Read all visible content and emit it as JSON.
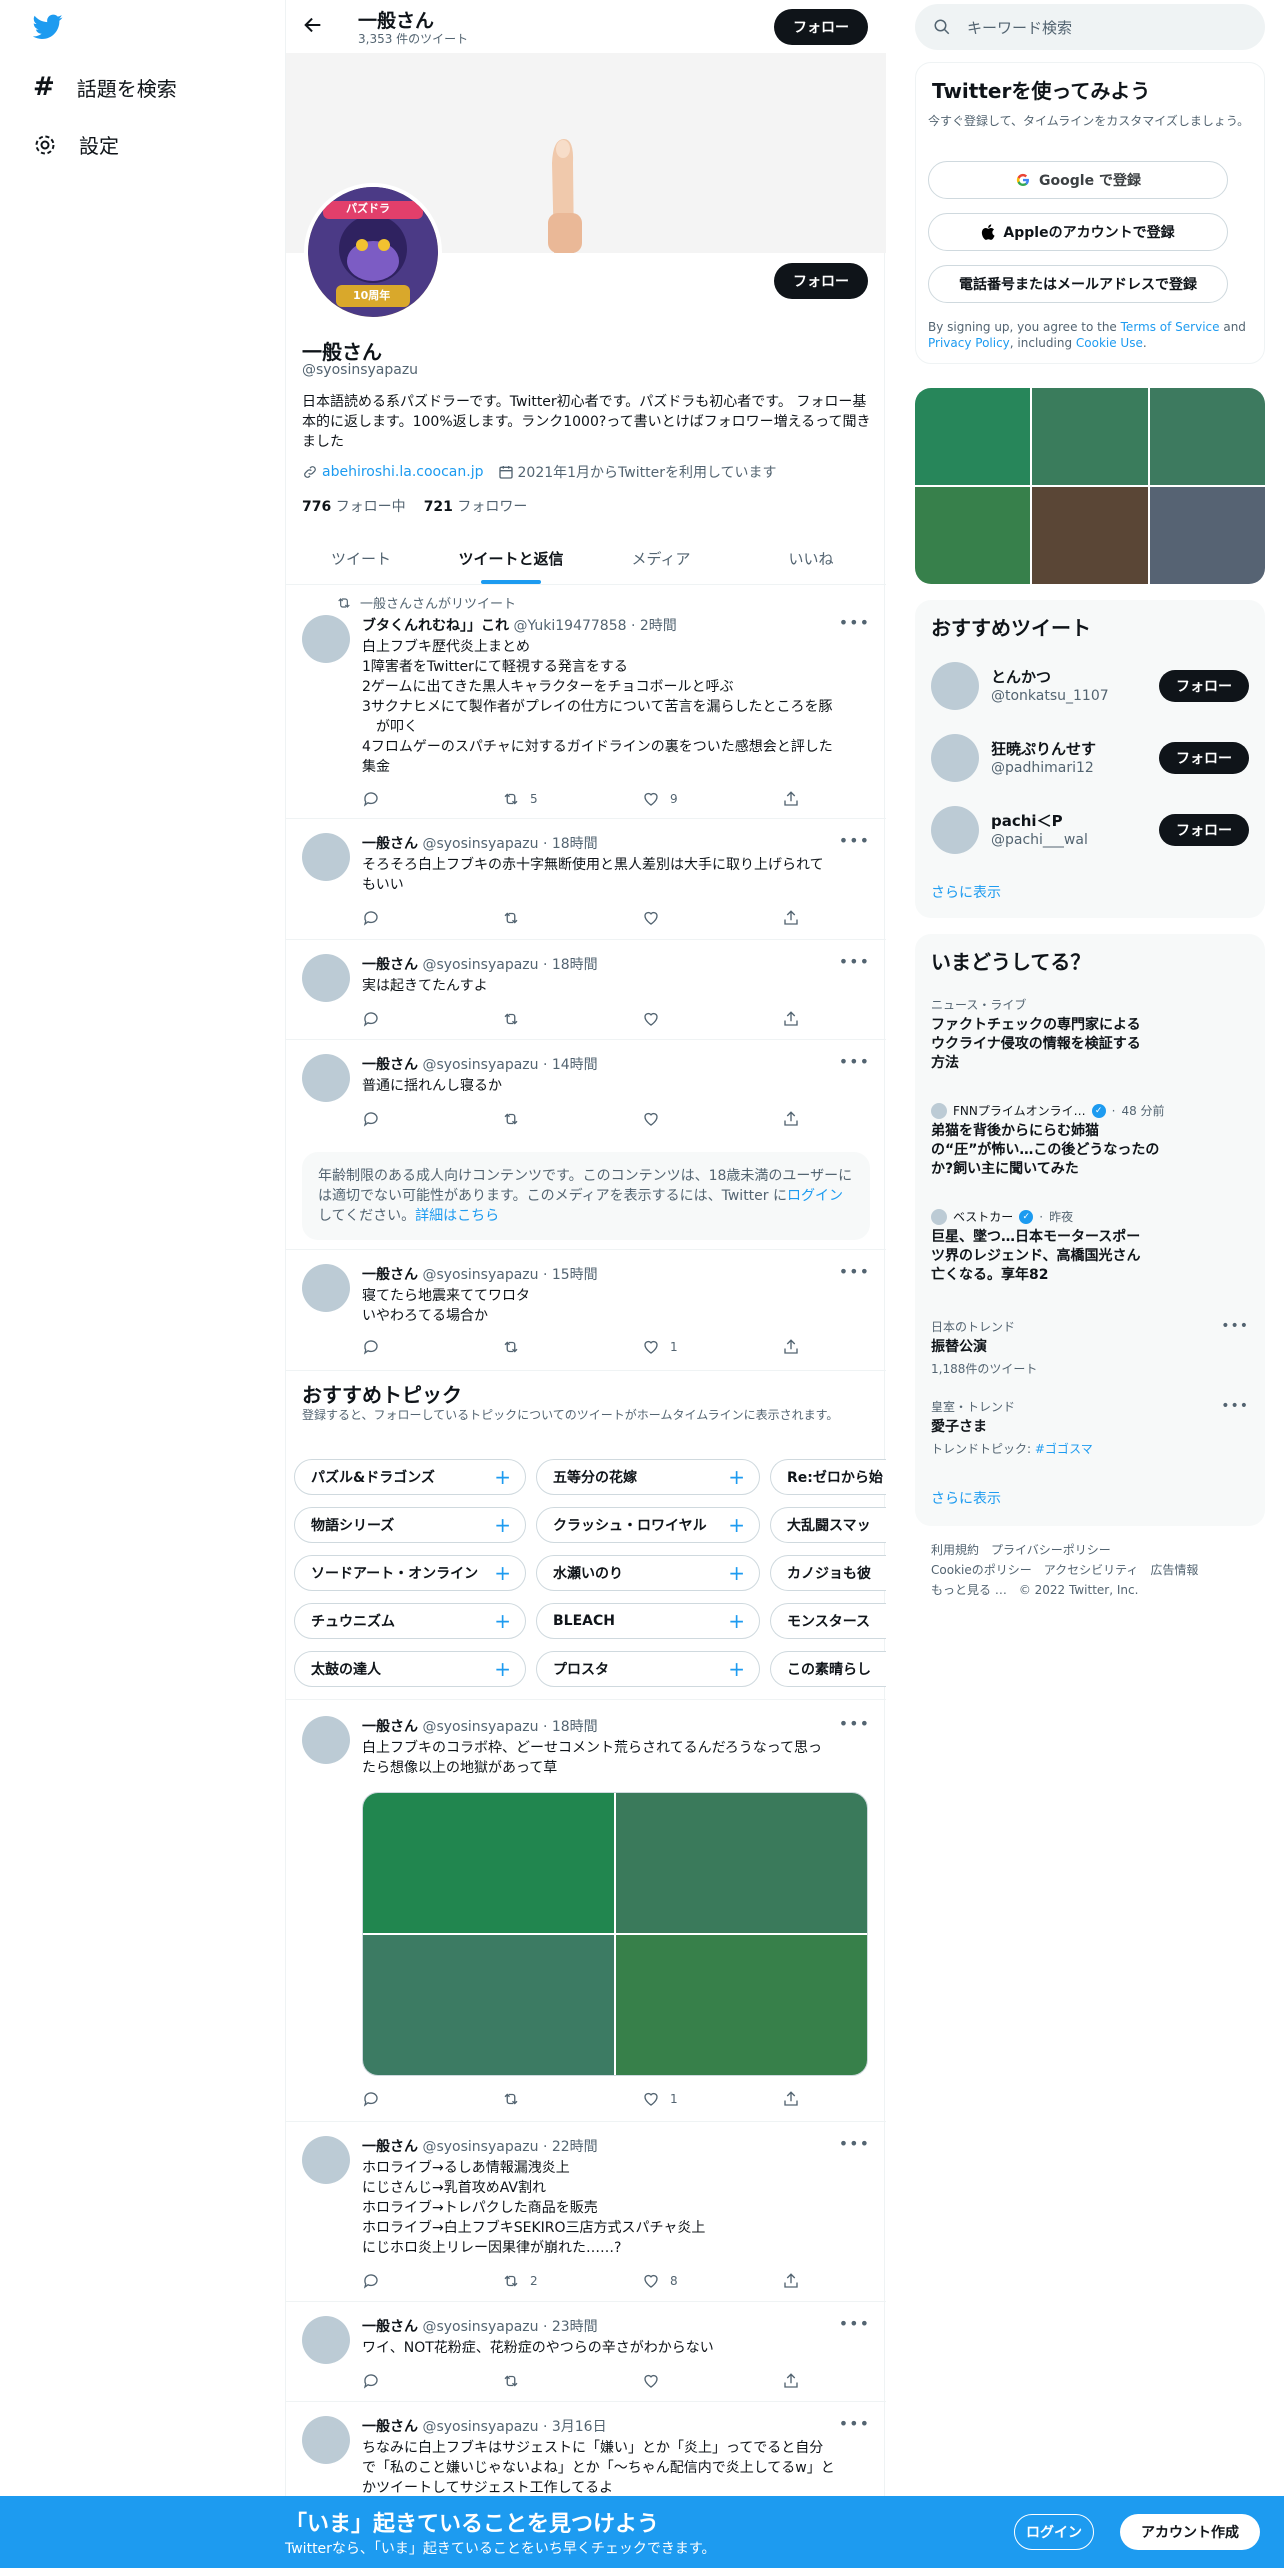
{
  "nav": {
    "explore_label": "話題を検索",
    "settings_label": "設定"
  },
  "header": {
    "name": "一般さん",
    "tweet_count": "3,353 件のツイート",
    "follow_label": "フォロー"
  },
  "profile": {
    "name": "一般さん",
    "handle": "@syosinsyapazu",
    "bio": "日本語読める系パズドラーです。Twitter初心者です。パズドラも初心者です。 フォロー基本的に返します。100%返します。ランク1000?って書いとけばフォロワー増えるって聞きました",
    "link": "abehiroshi.la.coocan.jp",
    "joined": "2021年1月からTwitterを利用しています",
    "following_count": "776",
    "following_label": "フォロー中",
    "followers_count": "721",
    "followers_label": "フォロワー",
    "follow_label": "フォロー",
    "avatar_badge": "パズドラ",
    "avatar_years": "10周年"
  },
  "tabs": [
    "ツイート",
    "ツイートと返信",
    "メディア",
    "いいね"
  ],
  "tweets": [
    {
      "retweet_line": "一般さんさんがリツイート",
      "name": "ブタくんれむね」」これ",
      "handle": "@Yuki19477858",
      "time": "2時間",
      "text": "白上フブキ歴代炎上まとめ\n1障害者をTwitterにて軽視する発言をする\n2ゲームに出てきた黒人キャラクターをチョコボールと呼ぶ\n3サクナヒメにて製作者がプレイの仕方について苦言を漏らしたところを豚\n　が叩く\n4フロムゲーのスパチャに対するガイドラインの裏をついた感想会と評した\n集金",
      "retweets": "5",
      "likes": "9"
    },
    {
      "name": "一般さん",
      "handle": "@syosinsyapazu",
      "time": "18時間",
      "text": "そろそろ白上フブキの赤十字無断使用と黒人差別は大手に取り上げられて\nもいい"
    },
    {
      "name": "一般さん",
      "handle": "@syosinsyapazu",
      "time": "18時間",
      "text": "実は起きてたんすよ"
    },
    {
      "name": "一般さん",
      "handle": "@syosinsyapazu",
      "time": "14時間",
      "text": "普通に揺れんし寝るか"
    },
    {
      "name": "一般さん",
      "handle": "@syosinsyapazu",
      "time": "15時間",
      "text": "寝てたら地震来ててワロタ\nいやわろてる場合か",
      "likes": "1"
    },
    {
      "name": "一般さん",
      "handle": "@syosinsyapazu",
      "time": "18時間",
      "text": "白上フブキのコラボ枠、どーせコメント荒らされてるんだろうなって思っ\nたら想像以上の地獄があって草",
      "likes": "1"
    },
    {
      "name": "一般さん",
      "handle": "@syosinsyapazu",
      "time": "22時間",
      "text": "ホロライブ→るしあ情報漏洩炎上\nにじさんじ→乳首攻めAV割れ\nホロライブ→トレパクした商品を販売\nホロライブ→白上フブキSEKIRO三店方式スパチャ炎上\nにじホロ炎上リレー因果律が崩れた……?",
      "retweets": "2",
      "likes": "8"
    },
    {
      "name": "一般さん",
      "handle": "@syosinsyapazu",
      "time": "23時間",
      "text": "ワイ、NOT花粉症、花粉症のやつらの辛さがわからない"
    },
    {
      "name": "一般さん",
      "handle": "@syosinsyapazu",
      "time": "3月16日",
      "text": "ちなみに白上フブキはサジェストに「嫌い」とか「炎上」ってでると自分\nで「私のこと嫌いじゃないよね」とか「〜ちゃん配信内で炎上してるw」と\nかツイートしてサジェスト工作してるよ"
    }
  ],
  "notice": {
    "text": "年齢制限のある成人向けコンテンツです。このコンテンツは、18歳未満のユーザーには適切でない可能性があります。このメディアを表示するには、Twitter に",
    "login": "ログイン",
    "text2": "してください。",
    "details": "詳細はこちら"
  },
  "topics": {
    "title": "おすすめトピック",
    "subtitle": "登録すると、フォローしているトピックについてのツイートがホームタイムラインに表示されます。",
    "chips": [
      [
        "パズル&ドラゴンズ",
        "五等分の花嫁",
        "Re:ゼロから始"
      ],
      [
        "物語シリーズ",
        "クラッシュ・ロワイヤル",
        "大乱闘スマッ"
      ],
      [
        "ソードアート・オンライン",
        "水瀬いのり",
        "カノジョも彼"
      ],
      [
        "チュウニズム",
        "BLEACH",
        "モンスタース"
      ],
      [
        "太鼓の達人",
        "プロスタ",
        "この素晴らし"
      ]
    ]
  },
  "sidebar": {
    "search_placeholder": "キーワード検索",
    "signup": {
      "title": "Twitterを使ってみよう",
      "subtitle": "今すぐ登録して、タイムラインをカスタマイズしましょう。",
      "google": "Google で登録",
      "apple": "Appleのアカウントで登録",
      "phone": "電話番号またはメールアドレスで登録",
      "terms_prefix": "By signing up, you agree to the ",
      "terms": "Terms of Service",
      "and": " and ",
      "privacy": "Privacy Policy",
      "including": ", including ",
      "cookie": "Cookie Use",
      "dot": "."
    },
    "recommended": {
      "title": "おすすめツイート",
      "users": [
        {
          "name": "とんかつ",
          "handle": "@tonkatsu_1107"
        },
        {
          "name": "狂暁ぷりんせす",
          "handle": "@padhimari12"
        },
        {
          "name": "pachi＜P",
          "handle": "@pachi___wal"
        }
      ],
      "follow_label": "フォロー",
      "show_more": "さらに表示"
    },
    "trends": {
      "title": "いまどうしてる？",
      "items": [
        {
          "category": "ニュース・ライブ",
          "title": "ファクトチェックの専門家による\nウクライナ侵攻の情報を検証する\n方法"
        },
        {
          "category": "FNNプライムオンライ…",
          "time": "48 分前",
          "title": "弟猫を背後からにらむ姉猫\nの“圧”が怖い…この後どうなったの\nか?飼い主に聞いてみた"
        },
        {
          "category": "ベストカー",
          "time": "昨夜",
          "title": "巨星、墜つ…日本モータースポー\nツ界のレジェンド、高橋国光さん\n亡くなる。享年82"
        },
        {
          "category": "日本のトレンド",
          "title": "振替公演",
          "sub": "1,188件のツイート"
        },
        {
          "category": "皇室・トレンド",
          "title": "愛子さま",
          "sub": "トレンドトピック: ",
          "sub_link": "#ゴゴスマ"
        }
      ],
      "show_more": "さらに表示"
    },
    "footer": [
      "利用規約",
      "プライバシーポリシー",
      "Cookieのポリシー",
      "アクセシビリティ",
      "広告情報",
      "もっと見る …",
      "© 2022 Twitter, Inc."
    ]
  },
  "bottom": {
    "title": "「いま」起きていることを見つけよう",
    "subtitle": "Twitterなら、「いま」起きていることをいち早くチェックできます。",
    "login": "ログイン",
    "signup": "アカウント作成"
  },
  "colors": {
    "accent": "#1d9bf0",
    "text": "#0f1419",
    "secondary": "#536471"
  }
}
